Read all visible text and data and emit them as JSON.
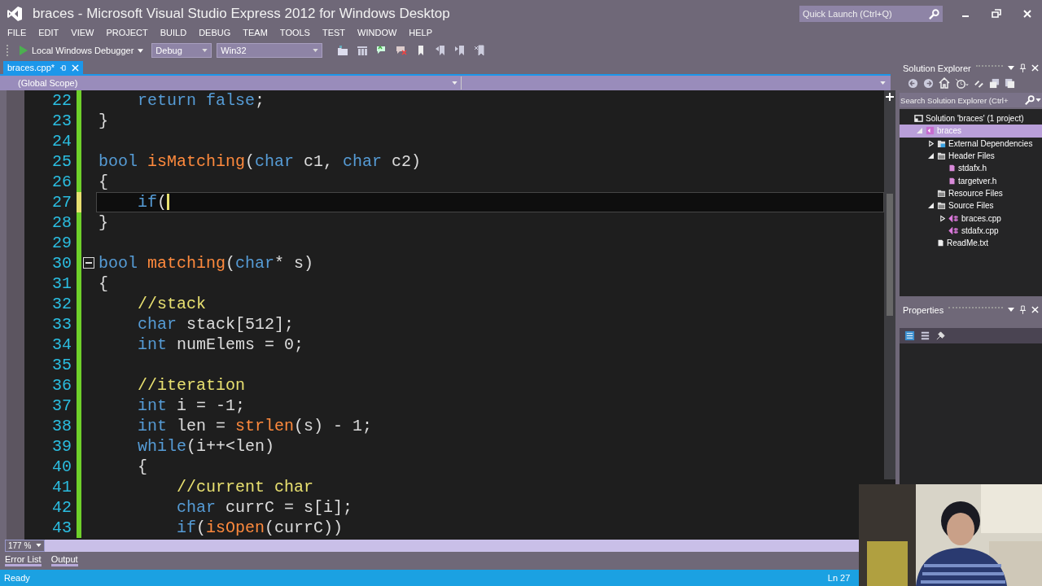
{
  "window": {
    "title": "braces - Microsoft Visual Studio Express 2012 for Windows Desktop",
    "quick_launch": {
      "placeholder": "Quick Launch (Ctrl+Q)"
    }
  },
  "menu": [
    "FILE",
    "EDIT",
    "VIEW",
    "PROJECT",
    "BUILD",
    "DEBUG",
    "TEAM",
    "TOOLS",
    "TEST",
    "WINDOW",
    "HELP"
  ],
  "toolbar": {
    "run_label": "Local Windows Debugger",
    "configuration": "Debug",
    "platform": "Win32"
  },
  "tabs": [
    {
      "label": "braces.cpp*",
      "selected": true
    }
  ],
  "scope": "(Global Scope)",
  "editor": {
    "lines": [
      {
        "number": "22",
        "modified": false,
        "current": false,
        "tokens": [
          {
            "kind": "keyword",
            "text": "    return"
          },
          {
            "kind": "keyword",
            "text": " false"
          },
          {
            "kind": "plain",
            "text": ";"
          }
        ]
      },
      {
        "number": "23",
        "modified": false,
        "current": false,
        "tokens": [
          {
            "kind": "plain",
            "text": "}"
          }
        ]
      },
      {
        "number": "24",
        "modified": false,
        "current": false
      },
      {
        "number": "25",
        "modified": false,
        "current": false,
        "tokens": [
          {
            "kind": "keyword",
            "text": "bool"
          },
          {
            "kind": "function",
            "text": " isMatching"
          },
          {
            "kind": "plain",
            "text": "("
          },
          {
            "kind": "keyword",
            "text": "char"
          },
          {
            "kind": "plain",
            "text": " c1, "
          },
          {
            "kind": "keyword",
            "text": "char"
          },
          {
            "kind": "plain",
            "text": " c2)"
          }
        ]
      },
      {
        "number": "26",
        "modified": false,
        "current": false,
        "tokens": [
          {
            "kind": "plain",
            "text": "{"
          }
        ]
      },
      {
        "number": "27",
        "modified": true,
        "current": true,
        "tokens": [
          {
            "kind": "keyword",
            "text": "    if"
          },
          {
            "kind": "plain",
            "text": "("
          }
        ]
      },
      {
        "number": "28",
        "modified": false,
        "current": false,
        "tokens": [
          {
            "kind": "plain",
            "text": "}"
          }
        ]
      },
      {
        "number": "29",
        "modified": false,
        "current": false
      },
      {
        "number": "30",
        "modified": false,
        "current": false,
        "fold": true,
        "tokens": [
          {
            "kind": "keyword",
            "text": "bool"
          },
          {
            "kind": "function",
            "text": " matching"
          },
          {
            "kind": "plain",
            "text": "("
          },
          {
            "kind": "keyword",
            "text": "char"
          },
          {
            "kind": "plain",
            "text": "* s)"
          }
        ]
      },
      {
        "number": "31",
        "modified": false,
        "current": false,
        "tokens": [
          {
            "kind": "plain",
            "text": "{"
          }
        ]
      },
      {
        "number": "32",
        "modified": false,
        "current": false,
        "tokens": [
          {
            "kind": "comment",
            "text": "    //stack"
          }
        ]
      },
      {
        "number": "33",
        "modified": false,
        "current": false,
        "tokens": [
          {
            "kind": "keyword",
            "text": "    char"
          },
          {
            "kind": "plain",
            "text": " stack[512];"
          }
        ]
      },
      {
        "number": "34",
        "modified": false,
        "current": false,
        "tokens": [
          {
            "kind": "keyword",
            "text": "    int"
          },
          {
            "kind": "plain",
            "text": " numElems = 0;"
          }
        ]
      },
      {
        "number": "35",
        "modified": false,
        "current": false
      },
      {
        "number": "36",
        "modified": false,
        "current": false,
        "tokens": [
          {
            "kind": "comment",
            "text": "    //iteration"
          }
        ]
      },
      {
        "number": "37",
        "modified": false,
        "current": false,
        "tokens": [
          {
            "kind": "keyword",
            "text": "    int"
          },
          {
            "kind": "plain",
            "text": " i = -1;"
          }
        ]
      },
      {
        "number": "38",
        "modified": false,
        "current": false,
        "tokens": [
          {
            "kind": "keyword",
            "text": "    int"
          },
          {
            "kind": "plain",
            "text": " len = "
          },
          {
            "kind": "function",
            "text": "strlen"
          },
          {
            "kind": "plain",
            "text": "(s) - 1;"
          }
        ]
      },
      {
        "number": "39",
        "modified": false,
        "current": false,
        "tokens": [
          {
            "kind": "keyword",
            "text": "    while"
          },
          {
            "kind": "plain",
            "text": "(i++<len)"
          }
        ]
      },
      {
        "number": "40",
        "modified": false,
        "current": false,
        "tokens": [
          {
            "kind": "plain",
            "text": "    {"
          }
        ]
      },
      {
        "number": "41",
        "modified": false,
        "current": false,
        "tokens": [
          {
            "kind": "comment",
            "text": "        //current char"
          }
        ]
      },
      {
        "number": "42",
        "modified": false,
        "current": false,
        "tokens": [
          {
            "kind": "keyword",
            "text": "        char"
          },
          {
            "kind": "plain",
            "text": " currC = s[i];"
          }
        ]
      },
      {
        "number": "43",
        "modified": false,
        "current": false,
        "tokens": [
          {
            "kind": "keyword",
            "text": "        if"
          },
          {
            "kind": "plain",
            "text": "("
          },
          {
            "kind": "function",
            "text": "isOpen"
          },
          {
            "kind": "plain",
            "text": "(currC))"
          }
        ]
      }
    ],
    "zoom": "177 %"
  },
  "solution_explorer": {
    "title": "Solution Explorer",
    "search": {
      "placeholder": "Search Solution Explorer (Ctrl+"
    },
    "tree": [
      {
        "label": "Solution 'braces' (1 project)",
        "kind": "solution",
        "selected": false,
        "children": [
          {
            "label": "braces",
            "kind": "project",
            "selected": true,
            "expanded": true,
            "children": [
              {
                "label": "External Dependencies",
                "kind": "deps",
                "selected": false,
                "expanded": false
              },
              {
                "label": "Header Files",
                "kind": "folder",
                "selected": false,
                "expanded": true,
                "children": [
                  {
                    "label": "stdafx.h",
                    "kind": "header",
                    "selected": false
                  },
                  {
                    "label": "targetver.h",
                    "kind": "header",
                    "selected": false
                  }
                ]
              },
              {
                "label": "Resource Files",
                "kind": "folder",
                "selected": false
              },
              {
                "label": "Source Files",
                "kind": "folder",
                "selected": false,
                "expanded": true,
                "children": [
                  {
                    "label": "braces.cpp",
                    "kind": "cpp",
                    "selected": false,
                    "expanded": false
                  },
                  {
                    "label": "stdafx.cpp",
                    "kind": "cpp",
                    "selected": false
                  }
                ]
              },
              {
                "label": "ReadMe.txt",
                "kind": "text",
                "selected": false
              }
            ]
          }
        ]
      }
    ]
  },
  "properties": {
    "title": "Properties"
  },
  "bottom_tabs": [
    {
      "label": "Error List"
    },
    {
      "label": "Output"
    }
  ],
  "status_bar": {
    "message": "Ready",
    "position": "Ln 27"
  }
}
